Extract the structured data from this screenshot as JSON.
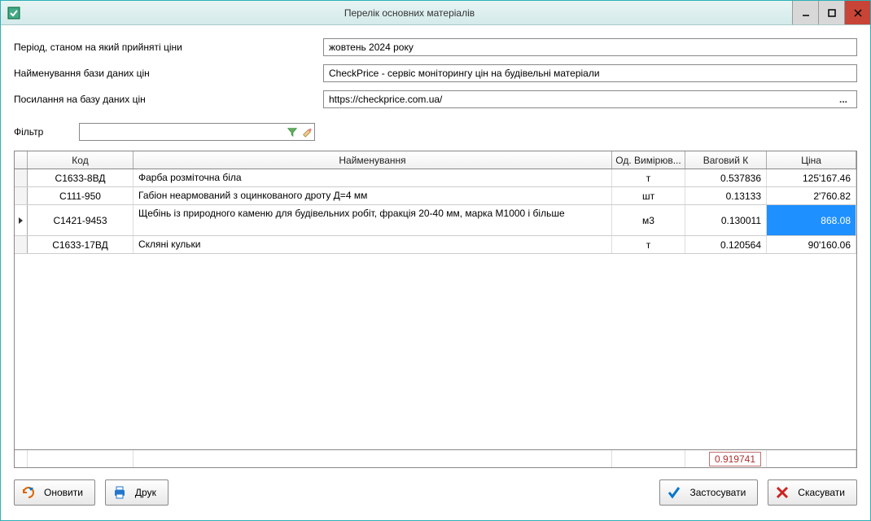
{
  "window": {
    "title": "Перелік основних матеріалів"
  },
  "form": {
    "period_label": "Період, станом на який прийняті ціни",
    "period_value": "жовтень 2024 року",
    "dbname_label": "Найменування бази даних цін",
    "dbname_value": "CheckPrice - сервіс моніторингу цін на будівельні матеріали",
    "dblink_label": "Посилання на базу даних цін",
    "dblink_value": "https://checkprice.com.ua/",
    "filter_label": "Фільтр",
    "filter_value": ""
  },
  "grid": {
    "headers": {
      "code": "Код",
      "name": "Найменування",
      "unit": "Од. Вимірюв...",
      "weight": "Ваговий К",
      "price": "Ціна"
    },
    "rows": [
      {
        "code": "С1633-8ВД",
        "name": "Фарба розміточна біла",
        "unit": "т",
        "weight": "0.537836",
        "price": "125'167.46",
        "selected": false,
        "tall": false
      },
      {
        "code": "С111-950",
        "name": "Габіон неармований з оцинкованого дроту Д=4 мм",
        "unit": "шт",
        "weight": "0.13133",
        "price": "2'760.82",
        "selected": false,
        "tall": false
      },
      {
        "code": "С1421-9453",
        "name": "Щебінь із природного каменю для будівельних робіт, фракція 20-40 мм, марка М1000 і більше",
        "unit": "м3",
        "weight": "0.130011",
        "price": "868.08",
        "selected": true,
        "tall": true
      },
      {
        "code": "С1633-17ВД",
        "name": "Скляні кульки",
        "unit": "т",
        "weight": "0.120564",
        "price": "90'160.06",
        "selected": false,
        "tall": false
      }
    ],
    "footer_sum": "0.919741"
  },
  "buttons": {
    "refresh": "Оновити",
    "print": "Друк",
    "apply": "Застосувати",
    "cancel": "Скасувати"
  }
}
